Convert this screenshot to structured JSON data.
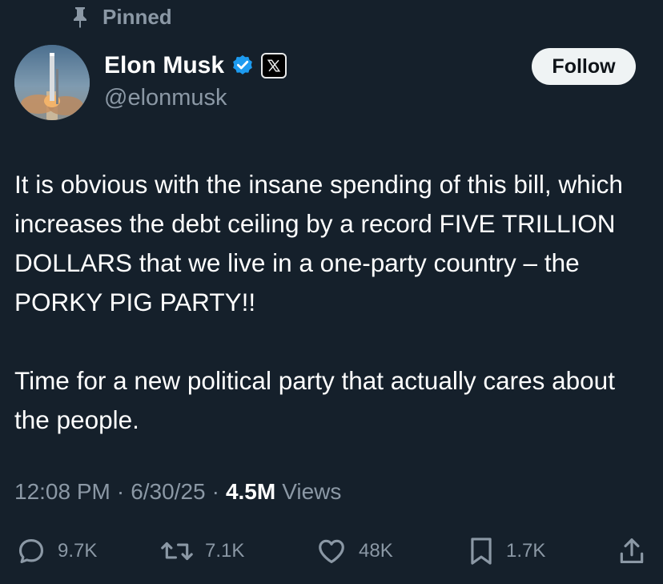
{
  "pinned_label": "Pinned",
  "author": {
    "display_name": "Elon Musk",
    "handle": "@elonmusk",
    "verified": true,
    "affiliate_badge": "x-logo-icon"
  },
  "follow_label": "Follow",
  "tweet": {
    "paragraphs": [
      "It is obvious with the insane spending of this bill, which increases the debt ceiling by a record FIVE TRILLION DOLLARS that we live in a one-party country – the PORKY PIG PARTY!!",
      "Time for a new political party that actually cares about the people."
    ]
  },
  "meta": {
    "time": "12:08 PM",
    "date": "6/30/25",
    "separator": "·",
    "views_count": "4.5M",
    "views_label": "Views"
  },
  "actions": {
    "replies": "9.7K",
    "reposts": "7.1K",
    "likes": "48K",
    "bookmarks": "1.7K"
  },
  "icons": {
    "pin": "pin-icon",
    "verified": "verified-badge-icon",
    "reply": "reply-icon",
    "repost": "repost-icon",
    "like": "heart-icon",
    "bookmark": "bookmark-icon",
    "share": "share-icon"
  },
  "colors": {
    "background": "#15202b",
    "secondary_text": "#8b98a5",
    "verified_blue": "#1d9bf0",
    "follow_button_bg": "#eff3f4"
  }
}
